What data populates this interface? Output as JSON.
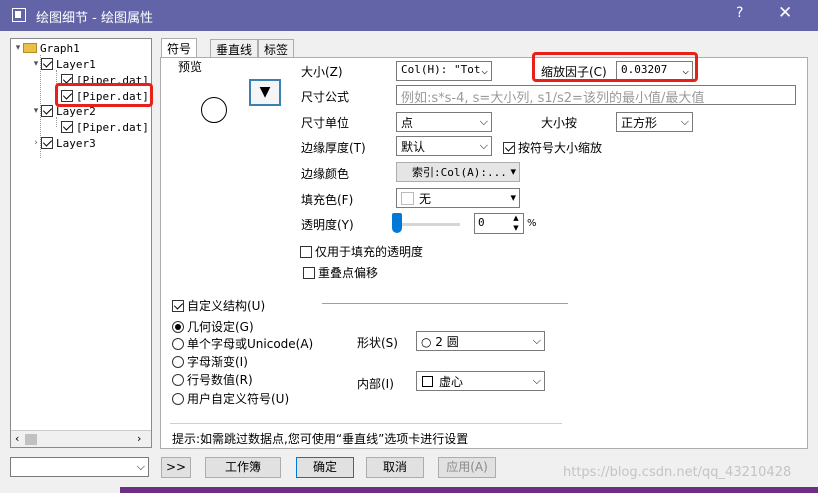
{
  "window": {
    "title": "绘图细节 - 绘图属性",
    "help": "?",
    "close": "✕"
  },
  "tree": {
    "graph": "Graph1",
    "layer1": "Layer1",
    "layer1_child1": "[Piper.dat]",
    "layer1_child2": "[Piper.dat]",
    "layer2": "Layer2",
    "layer2_child": "[Piper.dat]",
    "layer3": "Layer3"
  },
  "tabs": [
    "符号",
    "垂直线",
    "标签"
  ],
  "preview": {
    "label": "预览"
  },
  "fields": {
    "size_label": "大小(Z)",
    "size_value": "Col(H): \"Tot",
    "scale_label": "缩放因子(C)",
    "scale_value": "0.03207",
    "size_formula_label": "尺寸公式",
    "size_formula_placeholder": "例如:s*s-4, s=大小列, s1/s2=该列的最小值/最大值",
    "size_unit_label": "尺寸单位",
    "size_unit_value": "点",
    "size_by_label": "大小按",
    "size_by_value": "正方形",
    "edge_thickness_label": "边缘厚度(T)",
    "edge_thickness_value": "默认",
    "scale_with_symbol_label": "按符号大小缩放",
    "edge_color_label": "边缘颜色",
    "edge_color_value": "索引:Col(A):...",
    "fill_color_label": "填充色(F)",
    "fill_color_value": "无",
    "transparency_label": "透明度(Y)",
    "transparency_value": "0",
    "transparency_unit": "%",
    "transparency_fill_only_label": "仅用于填充的透明度",
    "overlap_offset_label": "重叠点偏移"
  },
  "structure": {
    "custom_label": "自定义结构(U)",
    "options": [
      "几何设定(G)",
      "单个字母或Unicode(A)",
      "字母渐变(I)",
      "行号数值(R)",
      "用户自定义符号(U)"
    ],
    "selected_index": 0,
    "shape_label": "形状(S)",
    "shape_value": "○ 2 圆",
    "interior_label": "内部(I)",
    "interior_value": "虚心"
  },
  "hint": "提示:如需跳过数据点,您可使用“垂直线”选项卡进行设置",
  "buttons": {
    "expand": ">>",
    "workbook": "工作簿",
    "ok": "确定",
    "cancel": "取消",
    "apply": "应用(A)"
  },
  "watermark": "https://blog.csdn.net/qq_43210428",
  "colors": {
    "titlebar": "#6264a7",
    "highlight": "#e8201a"
  }
}
